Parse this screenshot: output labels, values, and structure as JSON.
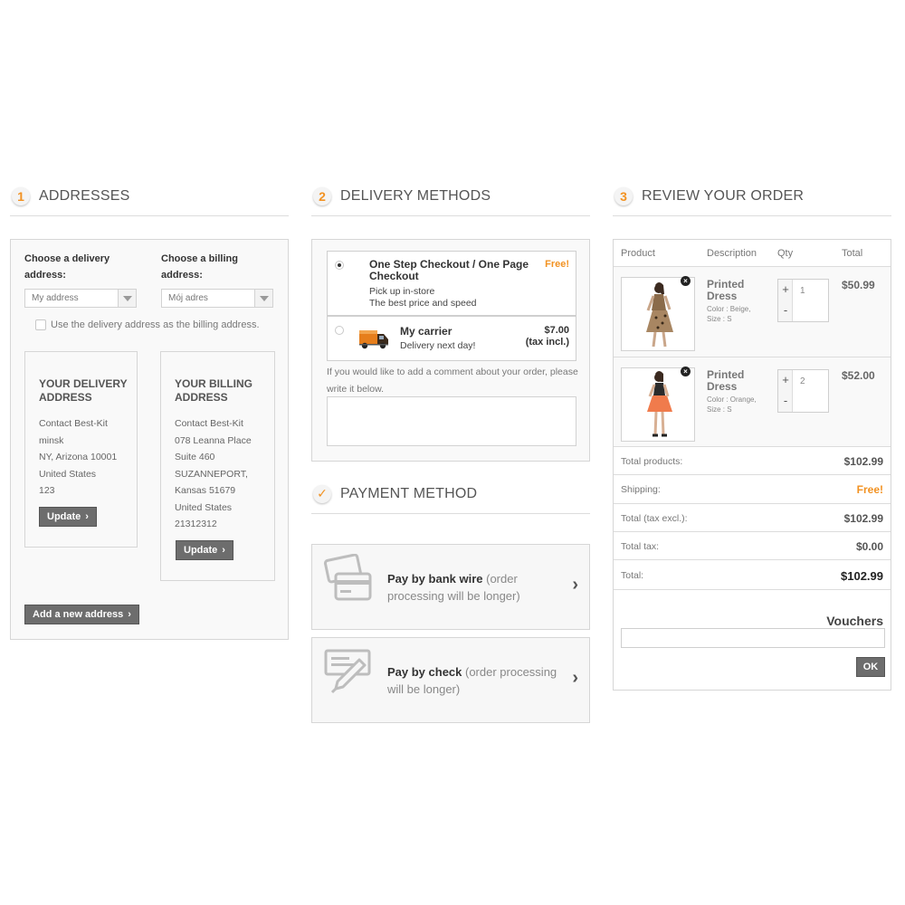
{
  "addresses": {
    "step": "1",
    "title": "ADDRESSES",
    "delivery_label_1": "Choose a delivery",
    "delivery_label_2": "address:",
    "billing_label_1": "Choose a billing",
    "billing_label_2": "address:",
    "delivery_select": "My address",
    "billing_select": "Mój adres",
    "same_address_label": "Use the delivery address as the billing address.",
    "delivery_box": {
      "title": "YOUR DELIVERY ADDRESS",
      "lines": [
        "Contact Best-Kit",
        "minsk",
        "NY, Arizona 10001",
        "United States",
        "123"
      ],
      "button": "Update"
    },
    "billing_box": {
      "title": "YOUR BILLING ADDRESS",
      "lines": [
        "Contact Best-Kit",
        "078 Leanna Place",
        "Suite 460",
        "SUZANNEPORT,",
        "Kansas 51679",
        "United States",
        "21312312"
      ],
      "button": "Update"
    },
    "add_button": "Add a new address"
  },
  "delivery": {
    "step": "2",
    "title": "DELIVERY METHODS",
    "carriers": [
      {
        "name_1": "One Step Checkout / One Page",
        "name_2": "Checkout",
        "sub_1": "Pick up in-store",
        "sub_2": "The best price and speed",
        "price": "Free!",
        "selected": true
      },
      {
        "name_1": "My carrier",
        "sub_1": "Delivery next day!",
        "price": "$7.00",
        "price_note": "(tax incl.)",
        "icon": "truck-icon",
        "selected": false
      }
    ],
    "comment_note": "If you would like to add a comment about your order, please write it below."
  },
  "payment": {
    "title": "PAYMENT METHOD",
    "methods": [
      {
        "bold": "Pay by bank wire",
        "muted": " (order processing will be longer)",
        "icon": "credit-card-icon"
      },
      {
        "bold": "Pay by check",
        "muted": " (order processing will be longer)",
        "icon": "check-pen-icon"
      }
    ]
  },
  "review": {
    "step": "3",
    "title": "REVIEW YOUR ORDER",
    "headers": {
      "product": "Product",
      "description": "Description",
      "qty": "Qty",
      "total": "Total"
    },
    "products": [
      {
        "name": "Printed Dress",
        "attrs": "Color : Beige, Size : S",
        "qty": "1",
        "total": "$50.99"
      },
      {
        "name": "Printed Dress",
        "attrs": "Color : Orange, Size : S",
        "qty": "2",
        "total": "$52.00"
      }
    ],
    "summary": {
      "total_products_label": "Total products:",
      "total_products": "$102.99",
      "shipping_label": "Shipping:",
      "shipping": "Free!",
      "tax_excl_label": "Total (tax excl.):",
      "tax_excl": "$102.99",
      "tax_label": "Total tax:",
      "tax": "$0.00",
      "total_label": "Total:",
      "total": "$102.99"
    },
    "vouchers_title": "Vouchers",
    "ok_button": "OK"
  },
  "colors": {
    "accent": "#f29222",
    "button": "#6d6d6d"
  }
}
